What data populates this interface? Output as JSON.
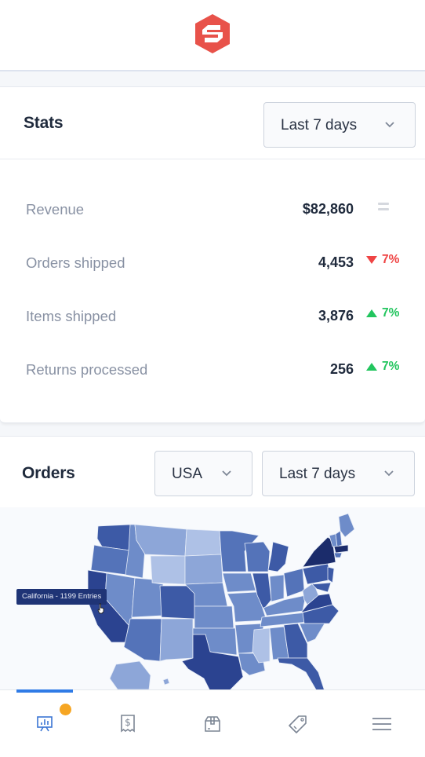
{
  "header": {
    "logo_icon": "hexagon-s-logo",
    "brand_color": "#e8524a"
  },
  "stats": {
    "title": "Stats",
    "period_select": {
      "value": "Last 7 days",
      "icon": "chevron-down-icon"
    },
    "rows": [
      {
        "label": "Revenue",
        "value": "$82,860",
        "trend": "flat",
        "delta": ""
      },
      {
        "label": "Orders shipped",
        "value": "4,453",
        "trend": "down",
        "delta": "7%"
      },
      {
        "label": "Items shipped",
        "value": "3,876",
        "trend": "up",
        "delta": "7%"
      },
      {
        "label": "Returns processed",
        "value": "256",
        "trend": "up",
        "delta": "7%"
      }
    ],
    "colors": {
      "up": "#22c55e",
      "down": "#ef4444",
      "flat": "#d5d8de"
    }
  },
  "orders": {
    "title": "Orders",
    "region_select": {
      "value": "USA",
      "icon": "chevron-down-icon"
    },
    "period_select": {
      "value": "Last 7 days",
      "icon": "chevron-down-icon"
    },
    "map": {
      "type": "choropleth",
      "region": "USA",
      "tooltip": "California - 1199 Entries",
      "color_scale": [
        "#aec1e6",
        "#8da6d8",
        "#6e8cc9",
        "#5473b9",
        "#3d5aa6",
        "#2b4390",
        "#1b2c6b"
      ]
    }
  },
  "bottom_nav": {
    "items": [
      {
        "name": "dashboard",
        "icon": "presentation-chart-icon",
        "active": true,
        "badge": true
      },
      {
        "name": "payments",
        "icon": "receipt-dollar-icon",
        "active": false
      },
      {
        "name": "orders",
        "icon": "package-box-icon",
        "active": false
      },
      {
        "name": "products",
        "icon": "price-tag-icon",
        "active": false
      },
      {
        "name": "menu",
        "icon": "hamburger-menu-icon",
        "active": false
      }
    ],
    "active_color": "#2f7be6",
    "badge_color": "#f6a623"
  }
}
